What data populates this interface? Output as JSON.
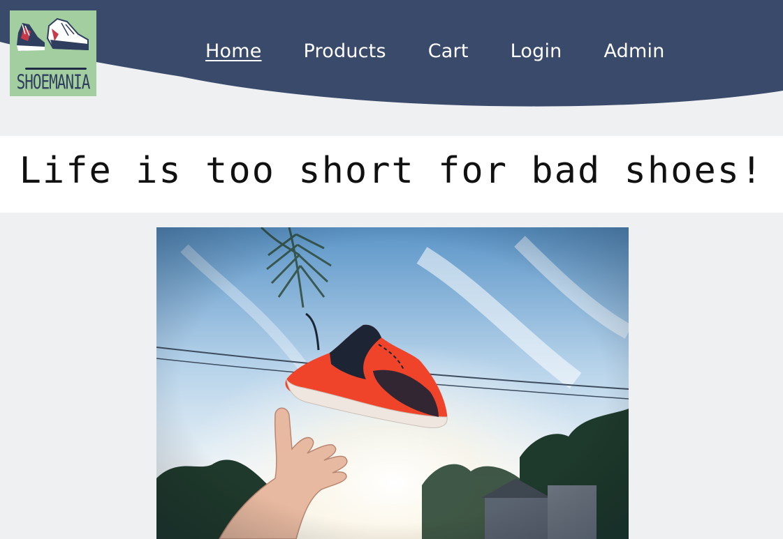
{
  "site": {
    "logo_text": "SHOEMANIA"
  },
  "nav": {
    "items": [
      {
        "label": "Home",
        "active": true
      },
      {
        "label": "Products",
        "active": false
      },
      {
        "label": "Cart",
        "active": false
      },
      {
        "label": "Login",
        "active": false
      },
      {
        "label": "Admin",
        "active": false
      }
    ]
  },
  "banner": {
    "tagline": "Life is too short for bad shoes!"
  },
  "colors": {
    "header": "#3a4a6b",
    "page_background": "#eff0f2",
    "logo_background": "#a3cfa0",
    "banner_background": "#ffffff",
    "shoe_accent": "#f0442a"
  }
}
